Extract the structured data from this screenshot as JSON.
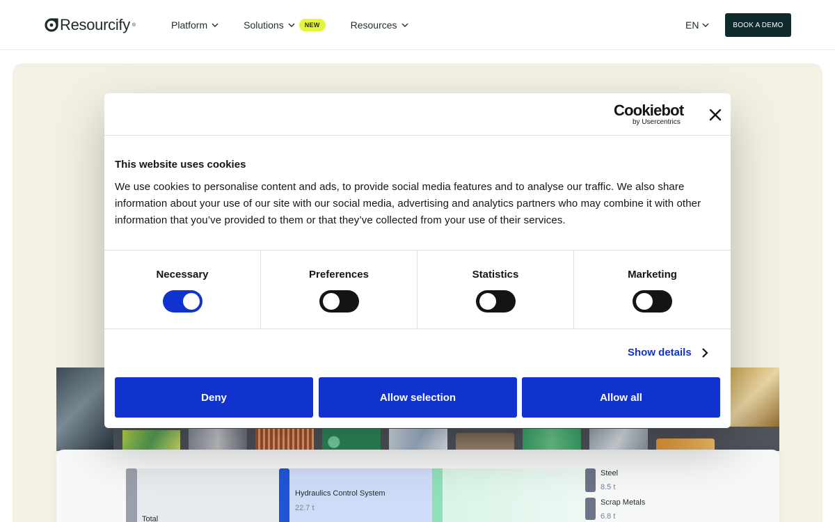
{
  "header": {
    "logo_text": "Resourcify",
    "logo_reg": "®",
    "nav": [
      {
        "label": "Platform",
        "icon": "chevron-down-icon"
      },
      {
        "label": "Solutions",
        "icon": "chevron-down-icon",
        "badge": "NEW"
      },
      {
        "label": "Resources",
        "icon": "chevron-down-icon"
      }
    ],
    "language": "EN",
    "demo_button": "BOOK A DEMO"
  },
  "chart_preview": {
    "total_label": "Total",
    "node_label": "Hydraulics Control System",
    "node_value": "22.7 t",
    "outputs": [
      {
        "label": "Steel",
        "value": "8.5 t"
      },
      {
        "label": "Scrap Metals",
        "value": "6.8 t"
      }
    ]
  },
  "cookie_banner": {
    "brand": "Cookiebot",
    "brand_sub": "by Usercentrics",
    "title": "This website uses cookies",
    "body": "We use cookies to personalise content and ads, to provide social media features and to analyse our traffic. We also share information about your use of our site with our social media, advertising and analytics partners who may combine it with other information that you’ve provided to them or that they’ve collected from your use of their services.",
    "categories": [
      {
        "label": "Necessary",
        "enabled": true
      },
      {
        "label": "Preferences",
        "enabled": false
      },
      {
        "label": "Statistics",
        "enabled": false
      },
      {
        "label": "Marketing",
        "enabled": false
      }
    ],
    "show_details": "Show details",
    "buttons": {
      "deny": "Deny",
      "allow_selection": "Allow selection",
      "allow_all": "Allow all"
    }
  },
  "colors": {
    "accent_blue": "#1032cf",
    "dark_green": "#0f2a2a",
    "badge_yellow": "#e5f53a",
    "hero_beige": "#f3f1e3"
  }
}
